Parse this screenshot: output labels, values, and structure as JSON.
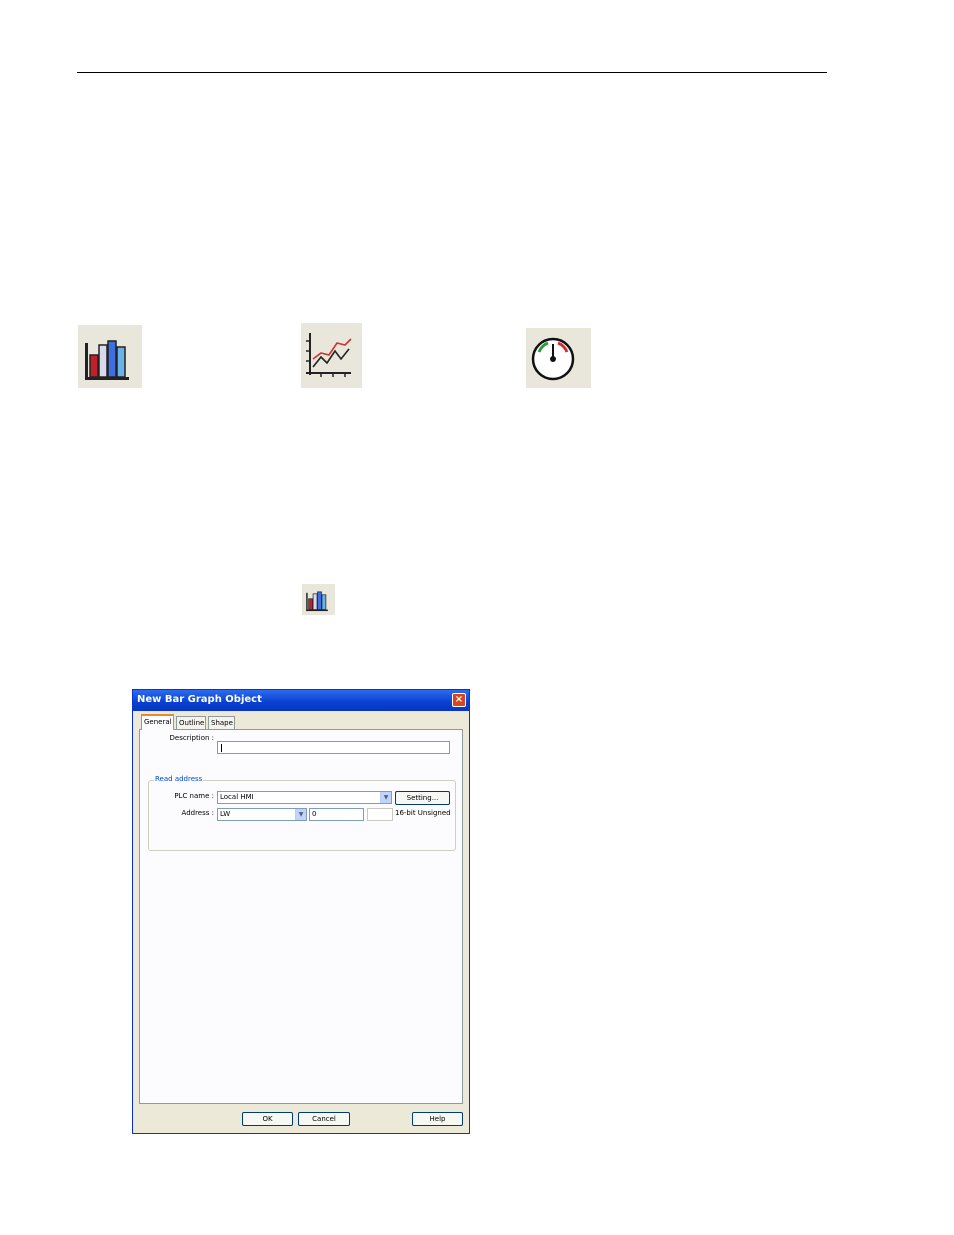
{
  "icons": {
    "bar_graph": "bar-graph-icon",
    "trend_display": "trend-display-icon",
    "meter_display": "meter-display-icon"
  },
  "dialog": {
    "title": "New  Bar Graph Object",
    "close_label": "×",
    "tabs": [
      "General",
      "Outline",
      "Shape"
    ],
    "description_label": "Description :",
    "description_value": "",
    "read_address_label": "Read address",
    "plc_name_label": "PLC name :",
    "plc_name_value": "Local HMI",
    "setting_button": "Setting...",
    "address_label": "Address :",
    "address_type_value": "LW",
    "address_value": "0",
    "data_type": "16-bit Unsigned",
    "ok_button": "OK",
    "cancel_button": "Cancel",
    "help_button": "Help"
  },
  "colors": {
    "title_bar": "#0a3fd0",
    "dialog_bg": "#ece9d8",
    "tab_highlight": "#e68b2c"
  }
}
